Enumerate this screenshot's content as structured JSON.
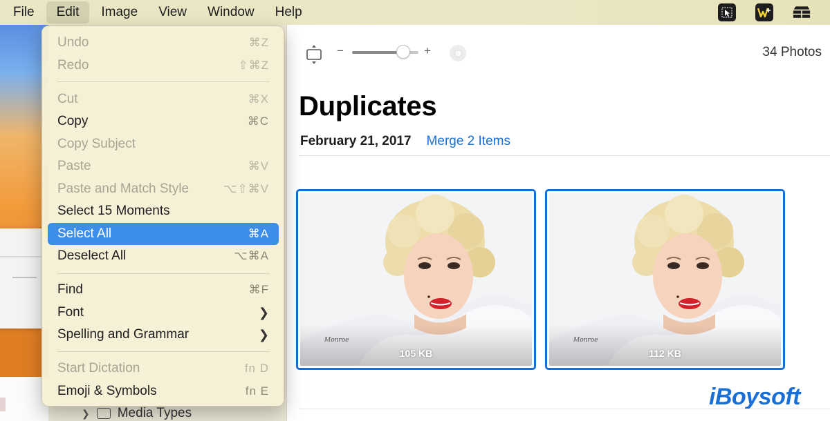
{
  "menubar": {
    "items": [
      "File",
      "Edit",
      "Image",
      "View",
      "Window",
      "Help"
    ],
    "active": "Edit",
    "tray_icons": [
      "pointer-app-icon",
      "wps-icon",
      "stack-icon"
    ]
  },
  "edit_menu": {
    "items": [
      {
        "label": "Undo",
        "shortcut": "⌘Z",
        "enabled": false
      },
      {
        "label": "Redo",
        "shortcut": "⇧⌘Z",
        "enabled": false
      },
      {
        "label": "Cut",
        "shortcut": "⌘X",
        "enabled": false
      },
      {
        "label": "Copy",
        "shortcut": "⌘C",
        "enabled": true
      },
      {
        "label": "Copy Subject",
        "shortcut": "",
        "enabled": false
      },
      {
        "label": "Paste",
        "shortcut": "⌘V",
        "enabled": false
      },
      {
        "label": "Paste and Match Style",
        "shortcut": "⌥⇧⌘V",
        "enabled": false
      },
      {
        "label": "Select 15 Moments",
        "shortcut": "",
        "enabled": true
      },
      {
        "label": "Select All",
        "shortcut": "⌘A",
        "enabled": true,
        "highlighted": true
      },
      {
        "label": "Deselect All",
        "shortcut": "⌥⌘A",
        "enabled": true
      },
      {
        "label": "Find",
        "shortcut": "⌘F",
        "enabled": true
      },
      {
        "label": "Font",
        "shortcut": "",
        "enabled": true,
        "submenu": true
      },
      {
        "label": "Spelling and Grammar",
        "shortcut": "",
        "enabled": true,
        "submenu": true
      },
      {
        "label": "Start Dictation",
        "shortcut": "fn D",
        "enabled": false
      },
      {
        "label": "Emoji & Symbols",
        "shortcut": "fn E",
        "enabled": true
      }
    ]
  },
  "toolbar": {
    "zoom_minus": "−",
    "zoom_plus": "+",
    "zoom_level": 0.75,
    "photo_count": "34 Photos"
  },
  "main": {
    "title": "Duplicates",
    "date": "February 21, 2017",
    "merge_link": "Merge 2 Items",
    "photos": [
      {
        "size": "105 KB",
        "selected": true
      },
      {
        "size": "112 KB",
        "selected": true
      }
    ]
  },
  "sidebar": {
    "media_types_label": "Media Types"
  },
  "watermark": "iBoysoft",
  "colors": {
    "accent": "#1a6fd6",
    "menu_highlight": "#3d8eea",
    "menubar_bg": "#e9e6c3"
  }
}
